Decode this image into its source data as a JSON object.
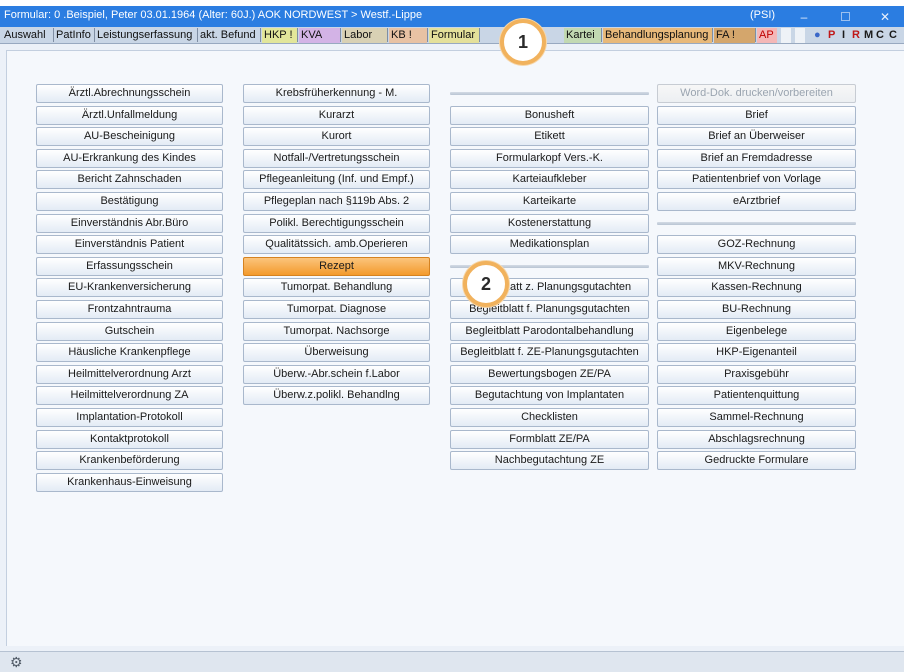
{
  "window": {
    "title": "Formular: 0  .Beispiel, Peter  03.01.1964 (Alter: 60J.)  AOK NORDWEST > Westf.-Lippe",
    "mode": "(PSI)",
    "minimize_glyph": "–",
    "close_glyph": "✕"
  },
  "tabs": [
    {
      "label": "Auswahl",
      "bg": "#c9d6e6",
      "color": "#101010"
    },
    {
      "label": "PatInfo",
      "bg": "#c9d6e6",
      "color": "#101010"
    },
    {
      "label": "Leistungserfassung",
      "bg": "#c9d6e6",
      "color": "#101010"
    },
    {
      "label": "akt. Befund",
      "bg": "#c9d6e6",
      "color": "#101010"
    },
    {
      "label": "HKP !",
      "bg": "#e2e69a",
      "color": "#101010"
    },
    {
      "label": "KVA",
      "bg": "#d3b3e6",
      "color": "#101010"
    },
    {
      "label": "Labor",
      "bg": "#d9d1b4",
      "color": "#101010"
    },
    {
      "label": "KB !",
      "bg": "#e8c2a4",
      "color": "#101010"
    },
    {
      "label": "Formular",
      "bg": "#e4e09a",
      "color": "#101010"
    },
    {
      "label": "Kartei",
      "bg": "#c2d9b2",
      "color": "#101010"
    },
    {
      "label": "Behandlungsplanung",
      "bg": "#e8b97a",
      "color": "#101010"
    },
    {
      "label": "FA !",
      "bg": "#d4a66c",
      "color": "#101010"
    },
    {
      "label": "AP",
      "bg": "#f4b7b7",
      "color": "#c00000"
    }
  ],
  "toolbar_icons": [
    {
      "label": "●",
      "color": "#3a67c8"
    },
    {
      "label": "P",
      "color": "#c01818"
    },
    {
      "label": "I",
      "color": "#1a1a1a"
    },
    {
      "label": "R",
      "color": "#c01818"
    },
    {
      "label": "M",
      "color": "#1a1a1a"
    },
    {
      "label": "C",
      "color": "#1a1a1a"
    },
    {
      "label": "C",
      "color": "#1a1a1a"
    }
  ],
  "columns": [
    [
      "Ärztl.Abrechnungsschein",
      "Ärztl.Unfallmeldung",
      "AU-Bescheinigung",
      "AU-Erkrankung des Kindes",
      "Bericht Zahnschaden",
      "Bestätigung",
      "Einverständnis Abr.Büro",
      "Einverständnis Patient",
      "Erfassungsschein",
      "EU-Krankenversicherung",
      "Frontzahntrauma",
      "Gutschein",
      "Häusliche Krankenpflege",
      "Heilmittelverordnung Arzt",
      "Heilmittelverordnung ZA",
      "Implantation-Protokoll",
      "Kontaktprotokoll",
      "Krankenbeförderung",
      "Krankenhaus-Einweisung"
    ],
    [
      "Krebsfrüherkennung - M.",
      "Kurarzt",
      "Kurort",
      "Notfall-/Vertretungsschein",
      "Pflegeanleitung (Inf. und Empf.)",
      "Pflegeplan nach §119b Abs. 2",
      "Polikl. Berechtigungsschein",
      "Qualitätssich. amb.Operieren",
      "Rezept",
      "Tumorpat. Behandlung",
      "Tumorpat. Diagnose",
      "Tumorpat. Nachsorge",
      "Überweisung",
      "Überw.-Abr.schein f.Labor",
      "Überw.z.polikl. Behandlng"
    ],
    [
      "Bonusheft",
      "Etikett",
      "Formularkopf Vers.-K.",
      "Karteiaufkleber",
      "Karteikarte",
      "Kostenerstattung",
      "Medikationsplan",
      "Begleitblatt z. Planungsgutachten",
      "Begleitblatt f. Planungsgutachten",
      "Begleitblatt Parodontalbehandlung",
      "Begleitblatt f. ZE-Planungsgutachten",
      "Bewertungsbogen ZE/PA",
      "Begutachtung von Implantaten",
      "Checklisten",
      "Formblatt ZE/PA",
      "Nachbegutachtung ZE"
    ],
    [
      "Word-Dok. drucken/vorbereiten",
      "Brief",
      "Brief an Überweiser",
      "Brief an Fremdadresse",
      "Patientenbrief von Vorlage",
      "eArztbrief",
      "GOZ-Rechnung",
      "MKV-Rechnung",
      "Kassen-Rechnung",
      "BU-Rechnung",
      "Eigenbelege",
      "HKP-Eigenanteil",
      "Praxisgebühr",
      "Patientenquittung",
      "Sammel-Rechnung",
      "Abschlagsrechnung",
      "Gedruckte Formulare"
    ]
  ],
  "selected_button": "Rezept",
  "disabled_button": "Word-Dok. drucken/vorbereiten",
  "callouts": [
    "1",
    "2"
  ],
  "accent_colors": {
    "titlebar": "#2b7de1",
    "selected": "#f39a2d",
    "callout_ring": "#f1b25d"
  },
  "status": {
    "settings_icon": "gear-icon"
  }
}
